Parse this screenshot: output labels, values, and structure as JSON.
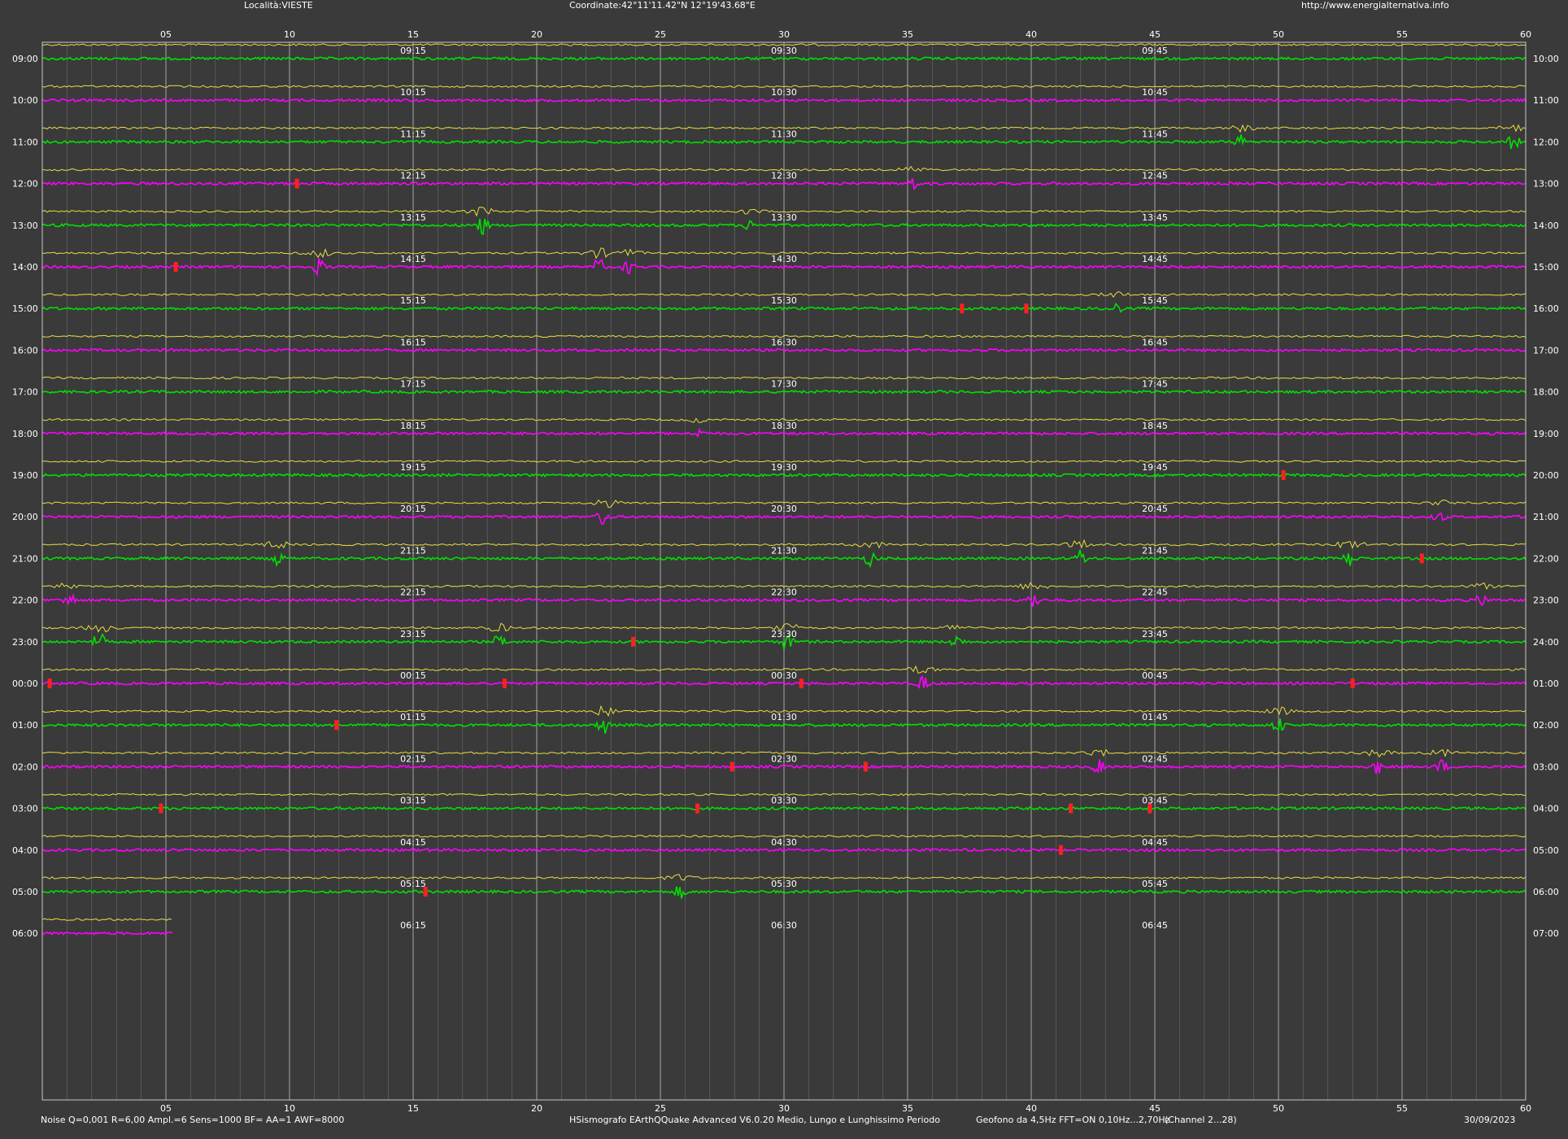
{
  "header": {
    "location": "Località:VIESTE",
    "coordinates": "Coordinate:42°11'11.42\"N  12°19'43.68\"E",
    "url": "http://www.energialternativa.info"
  },
  "footer": {
    "params": "Noise Q=0,001 R=6,00 Ampl.=6 Sens=1000 BF= AA=1 AWF=8000",
    "software": "HSismografo  EArthQQuake Advanced V6.0.20  Medio, Lungo e Lunghissimo Periodo",
    "sensor": "Geofono da 4,5Hz FFT=ON 0,10Hz...2,70Hz",
    "channel": "(Channel 2...28)",
    "date": "30/09/2023"
  },
  "colors": {
    "background": "#3a3a3a",
    "trace_green": "#00e000",
    "trace_magenta": "#ff00ff",
    "trace_yellow": "#e8e040",
    "event_marker": "#ff2020",
    "grid": "#8a8a8a",
    "text": "#ffffff"
  },
  "chart_data": {
    "type": "line",
    "title": "",
    "xlabel": "",
    "ylabel": "",
    "x_unit": "minutes",
    "xlim": [
      0,
      60
    ],
    "x_ticks": [
      "05",
      "10",
      "15",
      "20",
      "25",
      "30",
      "35",
      "40",
      "45",
      "50",
      "55",
      "60"
    ],
    "quarter_labels_suffix": [
      "15",
      "30",
      "45"
    ],
    "grid": true,
    "rows": [
      {
        "start": "09:00",
        "end": "10:00",
        "color": "green"
      },
      {
        "start": "10:00",
        "end": "11:00",
        "color": "magenta"
      },
      {
        "start": "11:00",
        "end": "12:00",
        "color": "green"
      },
      {
        "start": "12:00",
        "end": "13:00",
        "color": "magenta"
      },
      {
        "start": "13:00",
        "end": "14:00",
        "color": "green"
      },
      {
        "start": "14:00",
        "end": "15:00",
        "color": "magenta"
      },
      {
        "start": "15:00",
        "end": "16:00",
        "color": "green"
      },
      {
        "start": "16:00",
        "end": "17:00",
        "color": "magenta"
      },
      {
        "start": "17:00",
        "end": "18:00",
        "color": "green"
      },
      {
        "start": "18:00",
        "end": "19:00",
        "color": "magenta"
      },
      {
        "start": "19:00",
        "end": "20:00",
        "color": "green"
      },
      {
        "start": "20:00",
        "end": "21:00",
        "color": "magenta"
      },
      {
        "start": "21:00",
        "end": "22:00",
        "color": "green"
      },
      {
        "start": "22:00",
        "end": "23:00",
        "color": "magenta"
      },
      {
        "start": "23:00",
        "end": "24:00",
        "color": "green"
      },
      {
        "start": "00:00",
        "end": "01:00",
        "color": "magenta"
      },
      {
        "start": "01:00",
        "end": "02:00",
        "color": "green"
      },
      {
        "start": "02:00",
        "end": "03:00",
        "color": "magenta"
      },
      {
        "start": "03:00",
        "end": "04:00",
        "color": "green"
      },
      {
        "start": "04:00",
        "end": "05:00",
        "color": "magenta"
      },
      {
        "start": "05:00",
        "end": "06:00",
        "color": "green"
      },
      {
        "start": "06:00",
        "end": "07:00",
        "color": "magenta",
        "partial_until_minute": 5.3
      }
    ],
    "event_markers": [
      {
        "row": "12:00",
        "minute": 10.3
      },
      {
        "row": "14:00",
        "minute": 5.4
      },
      {
        "row": "15:00",
        "minute": 37.2
      },
      {
        "row": "15:00",
        "minute": 39.8
      },
      {
        "row": "19:00",
        "minute": 50.2
      },
      {
        "row": "21:00",
        "minute": 55.8
      },
      {
        "row": "23:00",
        "minute": 23.9
      },
      {
        "row": "00:00",
        "minute": 0.3
      },
      {
        "row": "00:00",
        "minute": 18.7
      },
      {
        "row": "00:00",
        "minute": 30.7
      },
      {
        "row": "00:00",
        "minute": 53.0
      },
      {
        "row": "01:00",
        "minute": 11.9
      },
      {
        "row": "02:00",
        "minute": 27.9
      },
      {
        "row": "02:00",
        "minute": 33.3
      },
      {
        "row": "03:00",
        "minute": 4.8
      },
      {
        "row": "03:00",
        "minute": 26.5
      },
      {
        "row": "03:00",
        "minute": 41.6
      },
      {
        "row": "03:00",
        "minute": 44.8
      },
      {
        "row": "04:00",
        "minute": 41.2
      },
      {
        "row": "05:00",
        "minute": 15.5
      }
    ],
    "disturbances": [
      {
        "row": "11:00",
        "minute": 48.5,
        "size": 0.7
      },
      {
        "row": "11:00",
        "minute": 59.5,
        "size": 0.8
      },
      {
        "row": "12:00",
        "minute": 35.2,
        "size": 0.6
      },
      {
        "row": "13:00",
        "minute": 17.8,
        "size": 1.0
      },
      {
        "row": "13:00",
        "minute": 28.6,
        "size": 0.5
      },
      {
        "row": "14:00",
        "minute": 11.2,
        "size": 0.9
      },
      {
        "row": "14:00",
        "minute": 22.5,
        "size": 1.0
      },
      {
        "row": "14:00",
        "minute": 23.7,
        "size": 0.7
      },
      {
        "row": "15:00",
        "minute": 43.4,
        "size": 0.6
      },
      {
        "row": "18:00",
        "minute": 26.5,
        "size": 0.5
      },
      {
        "row": "20:00",
        "minute": 22.7,
        "size": 1.0
      },
      {
        "row": "20:00",
        "minute": 56.5,
        "size": 0.6
      },
      {
        "row": "21:00",
        "minute": 9.5,
        "size": 0.8
      },
      {
        "row": "21:00",
        "minute": 33.5,
        "size": 0.8
      },
      {
        "row": "21:00",
        "minute": 42.0,
        "size": 0.9
      },
      {
        "row": "21:00",
        "minute": 52.9,
        "size": 0.9
      },
      {
        "row": "22:00",
        "minute": 1.1,
        "size": 0.8
      },
      {
        "row": "22:00",
        "minute": 40.1,
        "size": 0.9
      },
      {
        "row": "22:00",
        "minute": 58.2,
        "size": 0.6
      },
      {
        "row": "23:00",
        "minute": 2.3,
        "size": 1.0
      },
      {
        "row": "23:00",
        "minute": 18.5,
        "size": 0.8
      },
      {
        "row": "23:00",
        "minute": 30.1,
        "size": 1.0
      },
      {
        "row": "23:00",
        "minute": 37.0,
        "size": 0.7
      },
      {
        "row": "00:00",
        "minute": 35.6,
        "size": 0.8
      },
      {
        "row": "01:00",
        "minute": 22.7,
        "size": 1.0
      },
      {
        "row": "01:00",
        "minute": 50.0,
        "size": 0.8
      },
      {
        "row": "02:00",
        "minute": 42.7,
        "size": 0.8
      },
      {
        "row": "02:00",
        "minute": 54.0,
        "size": 0.8
      },
      {
        "row": "02:00",
        "minute": 56.6,
        "size": 0.7
      },
      {
        "row": "05:00",
        "minute": 25.8,
        "size": 0.7
      }
    ]
  }
}
